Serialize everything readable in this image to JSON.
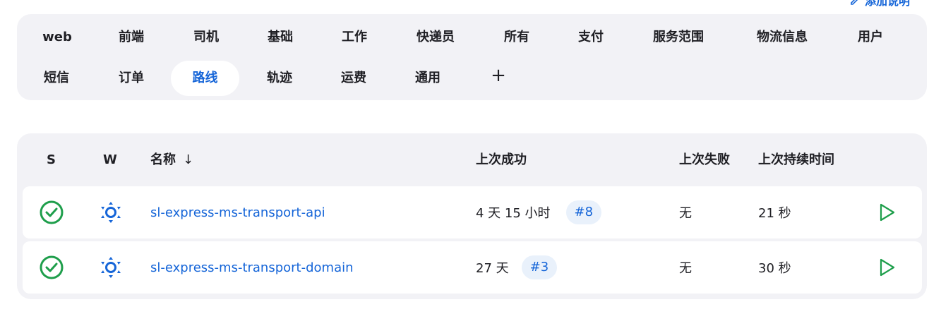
{
  "header": {
    "top_link": "添加说明",
    "colors": {
      "accent": "#1565d8",
      "success": "#1e9e4b",
      "panel": "#f2f2f6"
    }
  },
  "tabs": [
    {
      "label": "web"
    },
    {
      "label": "前端"
    },
    {
      "label": "司机"
    },
    {
      "label": "基础"
    },
    {
      "label": "工作"
    },
    {
      "label": "快递员"
    },
    {
      "label": "所有"
    },
    {
      "label": "支付"
    },
    {
      "label": "服务范围"
    },
    {
      "label": "物流信息"
    },
    {
      "label": "用户"
    },
    {
      "label": "短信"
    },
    {
      "label": "订单"
    },
    {
      "label": "路线",
      "active": true
    },
    {
      "label": "轨迹"
    },
    {
      "label": "运费"
    },
    {
      "label": "通用"
    },
    {
      "label": "+"
    }
  ],
  "table": {
    "columns": {
      "status": "S",
      "weather": "W",
      "name": "名称",
      "sort_arrow": "↓",
      "last_success": "上次成功",
      "last_failure": "上次失败",
      "last_duration": "上次持续时间"
    },
    "rows": [
      {
        "status_icon": "success-check-icon",
        "weather_icon": "sunny-icon",
        "name": "sl-express-ms-transport-api",
        "last_success": "4 天 15 小时",
        "build": "#8",
        "last_failure": "无",
        "last_duration": "21 秒",
        "action_icon": "play-icon"
      },
      {
        "status_icon": "success-check-icon",
        "weather_icon": "sunny-icon",
        "name": "sl-express-ms-transport-domain",
        "last_success": "27 天",
        "build": "#3",
        "last_failure": "无",
        "last_duration": "30 秒",
        "action_icon": "play-icon"
      }
    ]
  }
}
